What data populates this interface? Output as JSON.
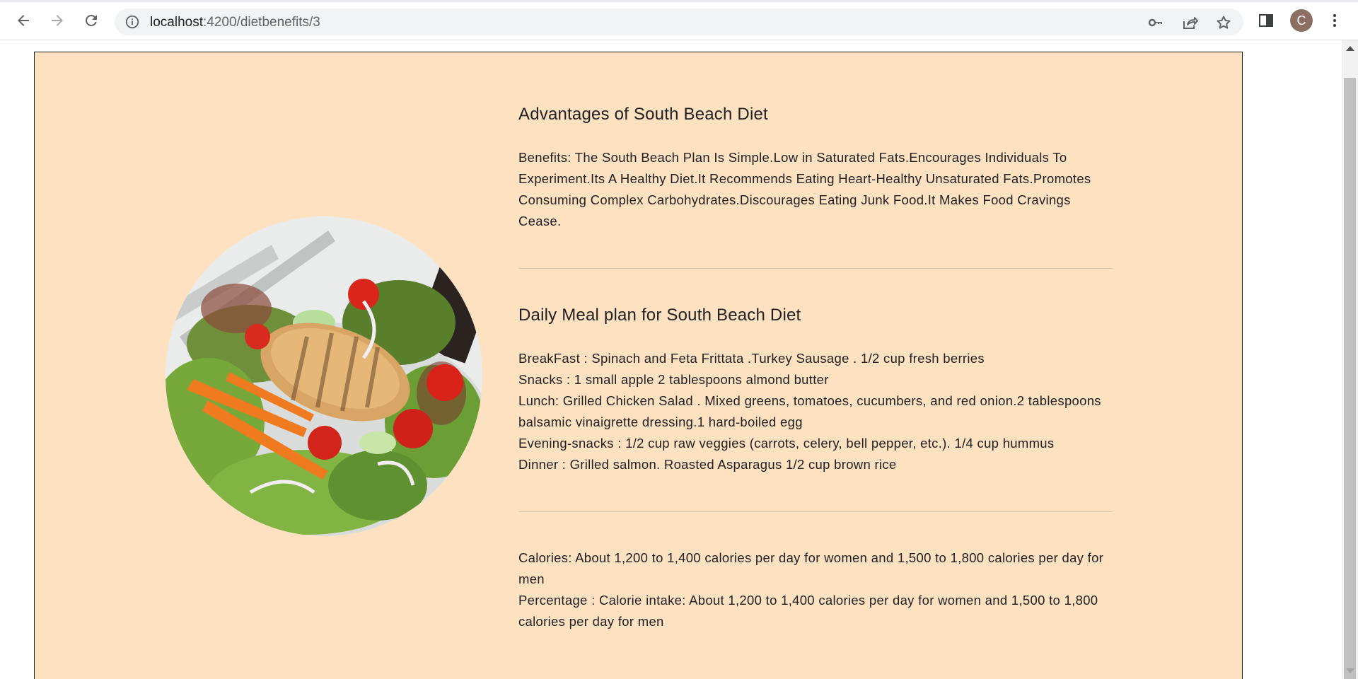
{
  "browser": {
    "url_host": "localhost",
    "url_path": ":4200/dietbenefits/3",
    "profile_initial": "C",
    "icons": [
      "back-arrow-icon",
      "forward-arrow-icon",
      "reload-icon",
      "info-icon",
      "key-icon",
      "share-icon",
      "star-icon",
      "side-panel-icon",
      "kebab-menu-icon"
    ]
  },
  "sections": {
    "advantages": {
      "title": "Advantages of South Beach Diet",
      "text": "Benefits: The South Beach Plan Is Simple.Low in Saturated Fats.Encourages Individuals To Experiment.Its A Healthy Diet.It Recommends Eating Heart-Healthy Unsaturated Fats.Promotes Consuming Complex Carbohydrates.Discourages Eating Junk Food.It Makes Food Cravings Cease."
    },
    "meal_plan": {
      "title": "Daily Meal plan for South Beach Diet",
      "breakfast": "BreakFast : Spinach and Feta Frittata .Turkey Sausage . 1/2 cup fresh berries",
      "snacks": "Snacks : 1 small apple 2 tablespoons almond butter",
      "lunch": "Lunch: Grilled Chicken Salad . Mixed greens, tomatoes, cucumbers, and red onion.2 tablespoons balsamic vinaigrette dressing.1 hard-boiled egg",
      "evening": "Evening-snacks : 1/2 cup raw veggies (carrots, celery, bell pepper, etc.). 1/4 cup hummus",
      "dinner": "Dinner : Grilled salmon. Roasted Asparagus 1/2 cup brown rice"
    },
    "calories": {
      "calories": "Calories: About 1,200 to 1,400 calories per day for women and 1,500 to 1,800 calories per day for men",
      "percentage": "Percentage : Calorie intake: About 1,200 to 1,400 calories per day for women and 1,500 to 1,800 calories per day for men"
    }
  },
  "colors": {
    "card_background": "#fde1c1",
    "text": "#212121",
    "avatar": "#8d6e63"
  }
}
